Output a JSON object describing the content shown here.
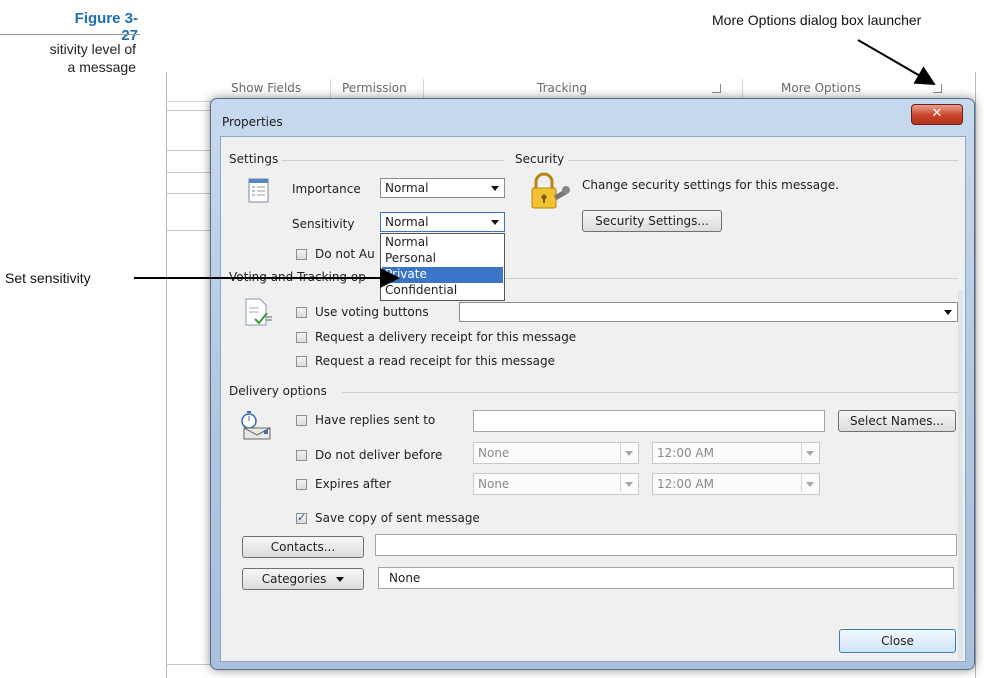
{
  "figure": {
    "number": "Figure 3-27",
    "caption_line1": "sitivity level of",
    "caption_line2": "a message"
  },
  "callouts": {
    "more_options_launcher": "More Options dialog box launcher",
    "set_sensitivity": "Set sensitivity"
  },
  "ribbon": {
    "show_fields": "Show Fields",
    "permission": "Permission",
    "tracking": "Tracking",
    "more_options": "More Options"
  },
  "dialog": {
    "title": "Properties",
    "close_glyph": "✕",
    "settings": {
      "label": "Settings",
      "importance_label": "Importance",
      "importance_value": "Normal",
      "sensitivity_label": "Sensitivity",
      "sensitivity_value": "Normal",
      "do_not_autoarchive_partial": "Do not Au"
    },
    "sensitivity_options": [
      "Normal",
      "Personal",
      "Private",
      "Confidential"
    ],
    "sensitivity_highlighted": "Private",
    "security": {
      "label": "Security",
      "text": "Change security settings for this message.",
      "button": "Security Settings..."
    },
    "voting": {
      "label_partial": "Voting and Tracking op",
      "use_voting_buttons": "Use voting buttons",
      "delivery_receipt": "Request a delivery receipt for this message",
      "read_receipt": "Request a read receipt for this message"
    },
    "delivery": {
      "label": "Delivery options",
      "have_replies_sent_to": "Have replies sent to",
      "select_names": "Select Names...",
      "do_not_deliver_before": "Do not deliver before",
      "deliver_date": "None",
      "deliver_time": "12:00 AM",
      "expires_after": "Expires after",
      "expires_date": "None",
      "expires_time": "12:00 AM",
      "save_copy": "Save copy of sent message",
      "save_copy_checked": true
    },
    "contacts_button": "Contacts...",
    "categories_button": "Categories",
    "categories_value": "None",
    "close_button": "Close"
  }
}
